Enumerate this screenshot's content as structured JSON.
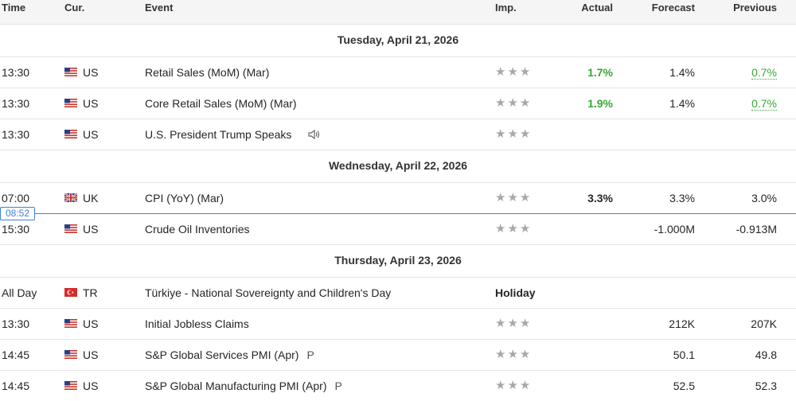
{
  "header": {
    "time": "Time",
    "currency": "Cur.",
    "event": "Event",
    "importance": "Imp.",
    "actual": "Actual",
    "forecast": "Forecast",
    "previous": "Previous"
  },
  "current_time": "08:52",
  "day1": {
    "label": "Tuesday, April 21, 2026",
    "r1": {
      "time": "13:30",
      "currency": "US",
      "event": "Retail Sales (MoM) (Mar)",
      "importance": "★★★",
      "actual": "1.7%",
      "forecast": "1.4%",
      "previous": "0.7%"
    },
    "r2": {
      "time": "13:30",
      "currency": "US",
      "event": "Core Retail Sales (MoM) (Mar)",
      "importance": "★★★",
      "actual": "1.9%",
      "forecast": "1.4%",
      "previous": "0.7%"
    },
    "r3": {
      "time": "13:30",
      "currency": "US",
      "event": "U.S. President Trump Speaks",
      "importance": "★★★",
      "actual": "",
      "forecast": "",
      "previous": ""
    }
  },
  "day2": {
    "label": "Wednesday, April 22, 2026",
    "r1": {
      "time": "07:00",
      "currency": "UK",
      "event": "CPI (YoY) (Mar)",
      "importance": "★★★",
      "actual": "3.3%",
      "forecast": "3.3%",
      "previous": "3.0%"
    },
    "r2": {
      "time": "15:30",
      "currency": "US",
      "event": "Crude Oil Inventories",
      "importance": "★★★",
      "actual": "",
      "forecast": "-1.000M",
      "previous": "-0.913M"
    }
  },
  "day3": {
    "label": "Thursday, April 23, 2026",
    "r1": {
      "time": "All Day",
      "currency": "TR",
      "event": "Türkiye - National Sovereignty and Children's Day",
      "holiday": "Holiday"
    },
    "r2": {
      "time": "13:30",
      "currency": "US",
      "event": "Initial Jobless Claims",
      "importance": "★★★",
      "actual": "",
      "forecast": "212K",
      "previous": "207K"
    },
    "r3": {
      "time": "14:45",
      "currency": "US",
      "event": "S&P Global Services PMI (Apr)",
      "suffix": "P",
      "importance": "★★★",
      "actual": "",
      "forecast": "50.1",
      "previous": "49.8"
    },
    "r4": {
      "time": "14:45",
      "currency": "US",
      "event": "S&P Global Manufacturing PMI (Apr)",
      "suffix": "P",
      "importance": "★★★",
      "actual": "",
      "forecast": "52.5",
      "previous": "52.3"
    }
  },
  "colors": {
    "positive": "#36a832",
    "now_line": "#3f7fd8",
    "star": "#a8a8a8"
  },
  "icons": {
    "us": "us-flag-icon",
    "uk": "uk-flag-icon",
    "tr": "turkey-flag-icon",
    "speech": "speaker-icon"
  }
}
